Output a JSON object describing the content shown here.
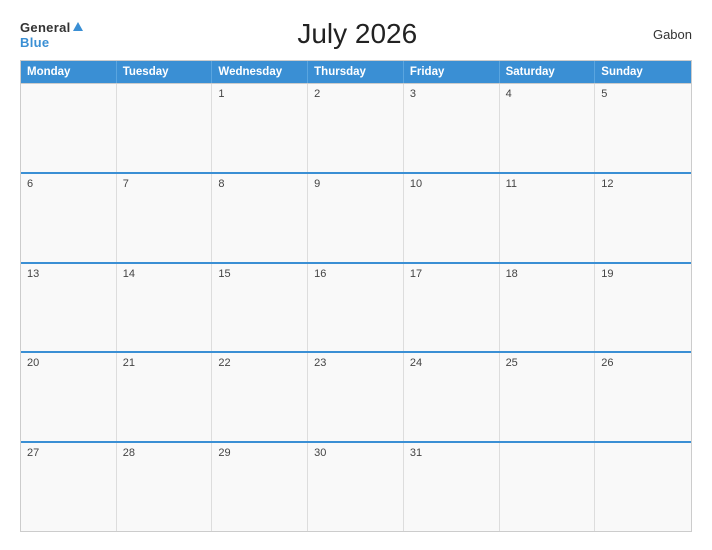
{
  "header": {
    "logo_general": "General",
    "logo_blue": "Blue",
    "title": "July 2026",
    "country": "Gabon"
  },
  "calendar": {
    "day_headers": [
      "Monday",
      "Tuesday",
      "Wednesday",
      "Thursday",
      "Friday",
      "Saturday",
      "Sunday"
    ],
    "weeks": [
      [
        {
          "day": "",
          "empty": true
        },
        {
          "day": "",
          "empty": true
        },
        {
          "day": "1"
        },
        {
          "day": "2"
        },
        {
          "day": "3"
        },
        {
          "day": "4"
        },
        {
          "day": "5"
        }
      ],
      [
        {
          "day": "6"
        },
        {
          "day": "7"
        },
        {
          "day": "8"
        },
        {
          "day": "9"
        },
        {
          "day": "10"
        },
        {
          "day": "11"
        },
        {
          "day": "12"
        }
      ],
      [
        {
          "day": "13"
        },
        {
          "day": "14"
        },
        {
          "day": "15"
        },
        {
          "day": "16"
        },
        {
          "day": "17"
        },
        {
          "day": "18"
        },
        {
          "day": "19"
        }
      ],
      [
        {
          "day": "20"
        },
        {
          "day": "21"
        },
        {
          "day": "22"
        },
        {
          "day": "23"
        },
        {
          "day": "24"
        },
        {
          "day": "25"
        },
        {
          "day": "26"
        }
      ],
      [
        {
          "day": "27"
        },
        {
          "day": "28"
        },
        {
          "day": "29"
        },
        {
          "day": "30"
        },
        {
          "day": "31"
        },
        {
          "day": "",
          "empty": true
        },
        {
          "day": "",
          "empty": true
        }
      ]
    ]
  }
}
